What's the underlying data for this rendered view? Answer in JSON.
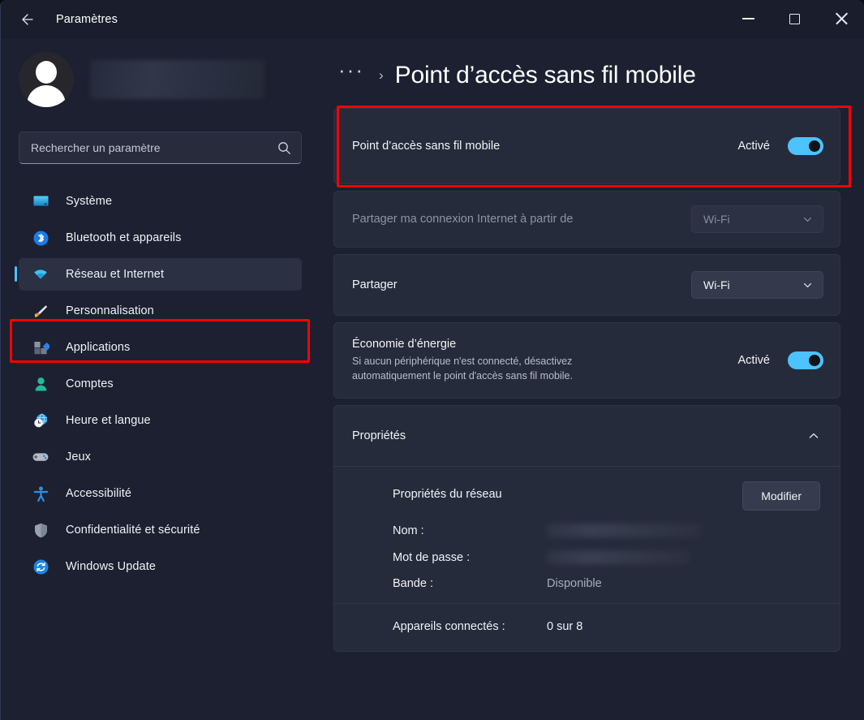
{
  "window": {
    "app_title": "Paramètres",
    "back_icon": "arrow-left-icon",
    "minimize_label": "Réduire",
    "maximize_label": "Agrandir",
    "close_label": "Fermer"
  },
  "sidebar": {
    "account": {
      "avatar_icon": "user-avatar-icon",
      "name_redacted": true
    },
    "search": {
      "placeholder": "Rechercher un paramètre",
      "value": "",
      "icon": "search-icon"
    },
    "items": [
      {
        "label": "Système",
        "icon": "monitor-icon",
        "active": false
      },
      {
        "label": "Bluetooth et appareils",
        "icon": "bluetooth-icon",
        "active": false
      },
      {
        "label": "Réseau et Internet",
        "icon": "wifi-icon",
        "active": true
      },
      {
        "label": "Personnalisation",
        "icon": "paintbrush-icon",
        "active": false
      },
      {
        "label": "Applications",
        "icon": "apps-icon",
        "active": false
      },
      {
        "label": "Comptes",
        "icon": "person-icon",
        "active": false
      },
      {
        "label": "Heure et langue",
        "icon": "globe-clock-icon",
        "active": false
      },
      {
        "label": "Jeux",
        "icon": "gamepad-icon",
        "active": false
      },
      {
        "label": "Accessibilité",
        "icon": "accessibility-icon",
        "active": false
      },
      {
        "label": "Confidentialité et sécurité",
        "icon": "shield-icon",
        "active": false
      },
      {
        "label": "Windows Update",
        "icon": "update-refresh-icon",
        "active": false
      }
    ]
  },
  "header": {
    "breadcrumb_overflow": "···",
    "breadcrumb_separator": "›",
    "title": "Point d’accès sans fil mobile"
  },
  "main": {
    "hotspot_toggle": {
      "label": "Point d’accès sans fil mobile",
      "state_text": "Activé",
      "state_on": true
    },
    "share_source": {
      "label": "Partager ma connexion Internet à partir de",
      "value": "Wi-Fi",
      "disabled": true,
      "chevron": "chevron-down-icon"
    },
    "share_over": {
      "label": "Partager",
      "value": "Wi-Fi",
      "disabled": false,
      "chevron": "chevron-down-icon"
    },
    "power_saving": {
      "title": "Économie d’énergie",
      "description": "Si aucun périphérique n'est connecté, désactivez automatiquement le point d'accès sans fil mobile.",
      "state_text": "Activé",
      "state_on": true
    },
    "properties": {
      "label": "Propriétés",
      "expanded": true,
      "chevron": "chevron-up-icon",
      "network_properties_label": "Propriétés du réseau",
      "edit_button": "Modifier",
      "fields": [
        {
          "key": "Nom :",
          "value": "",
          "redacted": true
        },
        {
          "key": "Mot de passe :",
          "value": "",
          "redacted": true
        },
        {
          "key": "Bande :",
          "value": "Disponible",
          "redacted": false
        }
      ],
      "devices": {
        "key": "Appareils connectés :",
        "value": "0 sur 8"
      }
    }
  },
  "annotations": {
    "accent_color": "#ff0000",
    "toggle_on_color": "#4cc2ff",
    "boxes": [
      {
        "name": "sidebar-network-highlight"
      },
      {
        "name": "hotspot-toggle-highlight"
      }
    ]
  }
}
